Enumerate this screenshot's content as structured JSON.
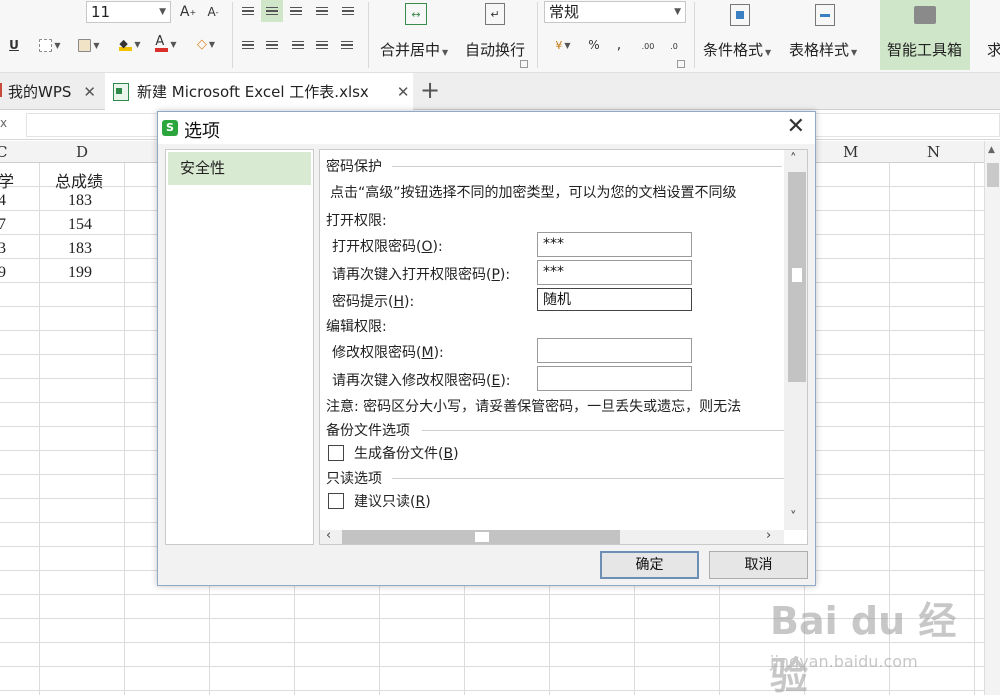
{
  "ribbon": {
    "font_size": "11",
    "number_format": "常规",
    "merge_center": "合并居中",
    "wrap_text": "自动换行",
    "conditional_format": "条件格式",
    "table_style": "表格样式",
    "smart_toolbox": "智能工具箱",
    "cut_off_label": "求"
  },
  "tabs": [
    {
      "label": "我的WPS"
    },
    {
      "label": "新建 Microsoft Excel 工作表.xlsx"
    }
  ],
  "formula_bar": {
    "fx_label": "x",
    "value": ""
  },
  "columns": [
    "C",
    "D",
    "M",
    "N"
  ],
  "cells": {
    "c1": "学",
    "d1": "总成绩",
    "c2": "4",
    "d2": "183",
    "c3": "7",
    "d3": "154",
    "c4": "3",
    "d4": "183",
    "c5": "9",
    "d5": "199"
  },
  "dialog": {
    "title": "选项",
    "sidebar": [
      {
        "label": "安全性"
      }
    ],
    "sections": {
      "password_protection": "密码保护",
      "description": "点击“高级”按钮选择不同的加密类型，可以为您的文档设置不同级",
      "open_permission": "打开权限:",
      "edit_permission": "编辑权限:",
      "backup": "备份文件选项",
      "readonly": "只读选项"
    },
    "fields": {
      "open_password_label": "打开权限密码(",
      "open_password_key": "O",
      "open_password_value": "***",
      "open_password_confirm_label": "请再次键入打开权限密码(",
      "open_password_confirm_key": "P",
      "open_password_confirm_value": "***",
      "hint_label": "密码提示(",
      "hint_key": "H",
      "hint_value": "随机",
      "modify_password_label": "修改权限密码(",
      "modify_password_key": "M",
      "modify_password_value": "",
      "modify_password_confirm_label": "请再次键入修改权限密码(",
      "modify_password_confirm_key": "E",
      "modify_password_confirm_value": "",
      "label_suffix": "):"
    },
    "note": "注意: 密码区分大小写，请妥善保管密码，一旦丢失或遗忘，则无法",
    "checkboxes": {
      "backup_label": "生成备份文件(",
      "backup_key": "B",
      "readonly_label": "建议只读(",
      "readonly_key": "R",
      "suffix": ")"
    },
    "buttons": {
      "ok": "确定",
      "cancel": "取消"
    }
  },
  "watermark": {
    "logo": "Bai du 经验",
    "url": "jingyan.baidu.com"
  }
}
